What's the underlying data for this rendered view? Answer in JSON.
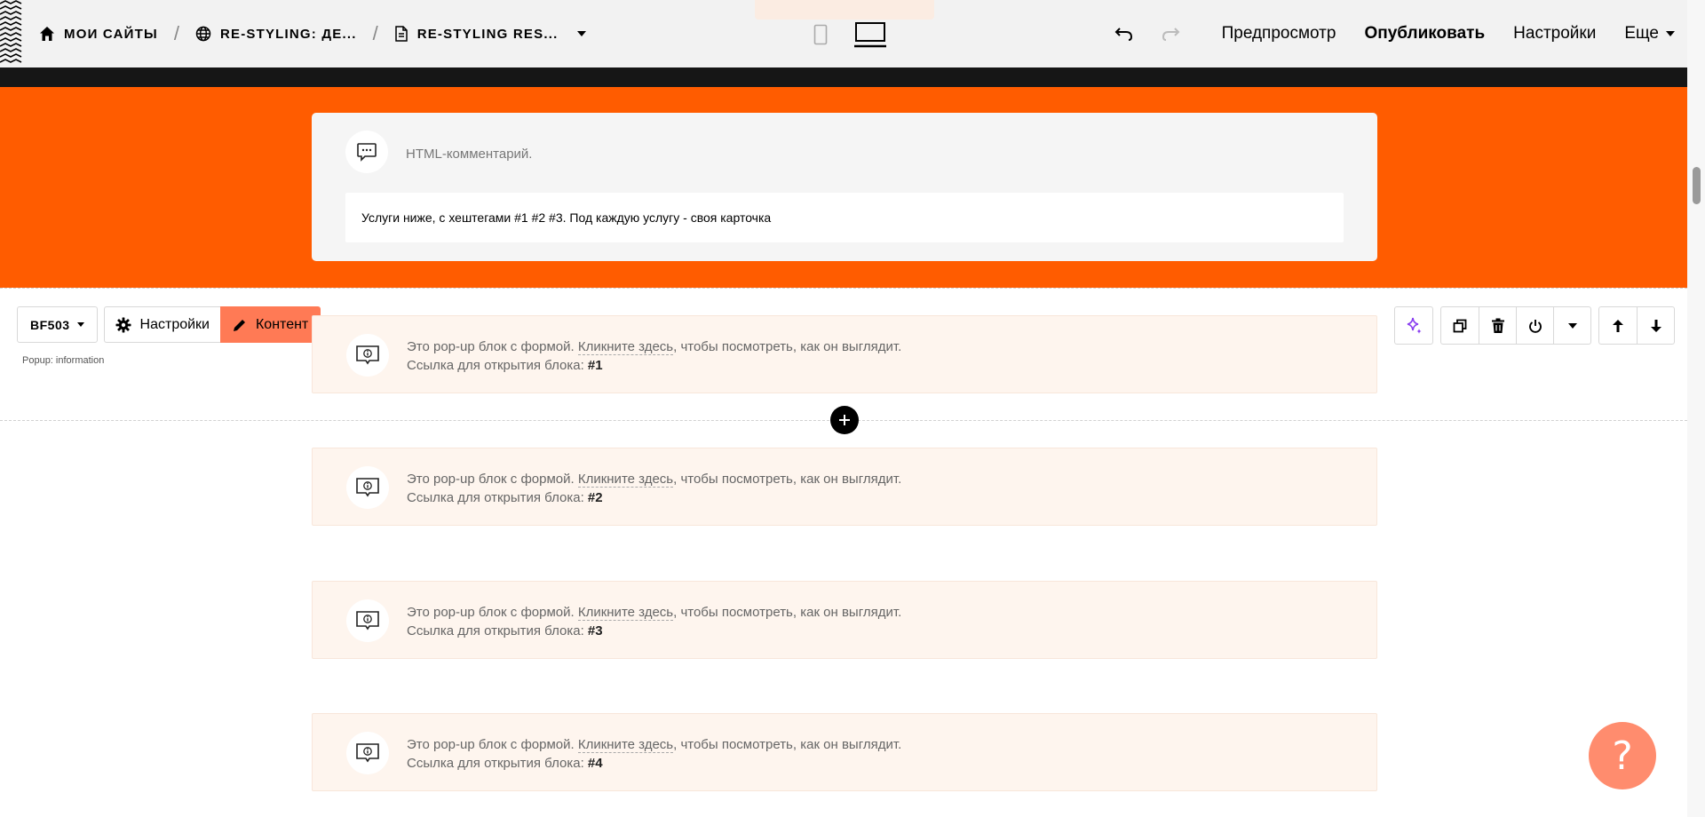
{
  "header": {
    "breadcrumbs": [
      {
        "label": "МОИ САЙТЫ",
        "icon": "home-icon"
      },
      {
        "label": "RE-STYLING: ДЕ...",
        "icon": "globe-icon"
      },
      {
        "label": "RE-STYLING RES...",
        "icon": "page-icon"
      }
    ],
    "separator": "/",
    "actions": {
      "preview": "Предпросмотр",
      "publish": "Опубликовать",
      "settings": "Настройки",
      "more": "Еще"
    }
  },
  "comment_block": {
    "label": "HTML-комментарий.",
    "text": "Услуги ниже, с хештегами #1 #2 #3. Под каждую услугу - своя карточка"
  },
  "block_controls": {
    "code": "BF503",
    "settings": "Настройки",
    "content": "Контент",
    "caption": "Popup: information"
  },
  "popups": [
    {
      "pre": "Это pop-up блок с формой. ",
      "link": "Кликните здесь",
      "post": ", чтобы посмотреть, как он выглядит.",
      "hook_label": "Ссылка для открытия блока: ",
      "hook": "#1"
    },
    {
      "pre": "Это pop-up блок с формой. ",
      "link": "Кликните здесь",
      "post": ", чтобы посмотреть, как он выглядит.",
      "hook_label": "Ссылка для открытия блока: ",
      "hook": "#2"
    },
    {
      "pre": "Это pop-up блок с формой. ",
      "link": "Кликните здесь",
      "post": ", чтобы посмотреть, как он выглядит.",
      "hook_label": "Ссылка для открытия блока: ",
      "hook": "#3"
    },
    {
      "pre": "Это pop-up блок с формой. ",
      "link": "Кликните здесь",
      "post": ", чтобы посмотреть, как он выглядит.",
      "hook_label": "Ссылка для открытия блока: ",
      "hook": "#4"
    }
  ],
  "help": "?",
  "colors": {
    "accent_orange": "#ff5c00",
    "content_button": "#ff7a55",
    "popup_bg": "#fef5ee",
    "help_button": "#ff8c6e"
  }
}
